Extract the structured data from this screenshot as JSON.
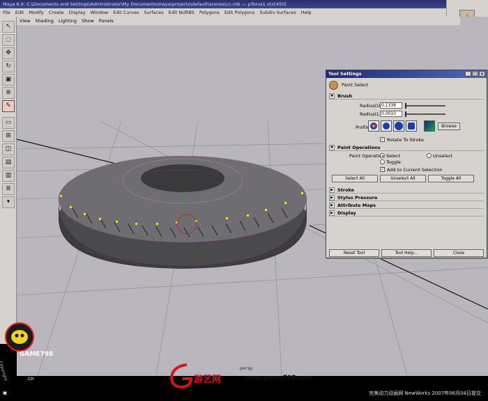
{
  "window": {
    "title": "Maya 6.0: C:\\Documents and Settings\\Administrator\\My Documents\\maya\\projects\\default\\scenes\\cc.mb  ---  pTorus1.vtx[450]"
  },
  "menubar": {
    "items": [
      "File",
      "Edit",
      "Modify",
      "Create",
      "Display",
      "Window",
      "Edit Curves",
      "Surfaces",
      "Edit NURBS",
      "Polygons",
      "Edit Polygons",
      "Subdiv Surfaces",
      "Help"
    ]
  },
  "panel": {
    "menu": [
      "View",
      "Shading",
      "Lighting",
      "Show",
      "Panels"
    ],
    "camera_label": "persp"
  },
  "tool_settings": {
    "title": "Tool Settings",
    "tool_name": "Paint Select",
    "brush": {
      "header": "Brush",
      "radius_u_label": "Radius(U)",
      "radius_u_value": "0.1338",
      "radius_l_label": "Radius(L)",
      "radius_l_value": "0.0010",
      "profile_label": "Profile",
      "browse_label": "Browse",
      "rotate_to_stroke": "Rotate To Stroke"
    },
    "paint_operations": {
      "header": "Paint Operations",
      "operation_label": "Paint Operation",
      "select_label": "Select",
      "unselect_label": "Unselect",
      "toggle_label": "Toggle",
      "add_to_selection": "Add to Current Selection",
      "select_all": "Select All",
      "unselect_all": "Unselect All",
      "toggle_all": "Toggle All"
    },
    "collapsed_sections": [
      "Stroke",
      "Stylus Pressure",
      "Attribute Maps",
      "Display"
    ],
    "footer": {
      "reset": "Reset Tool",
      "help": "Tool Help...",
      "close": "Close"
    }
  },
  "watermark": {
    "game_brand": "GAME798",
    "copyright": "Copyright",
    "site_cn": "游艺网",
    "site_url": "www.game798.com",
    "cn_suffix": ".cn",
    "caption": "完美动力动画网 NewWorks 2007年06月04日提交"
  },
  "colors": {
    "viewport_bg": "#b9b6bd",
    "selection_magenta": "#d020d0",
    "selected_vertex_yellow": "#f0e020",
    "title_bar": "#2a2e6e"
  }
}
